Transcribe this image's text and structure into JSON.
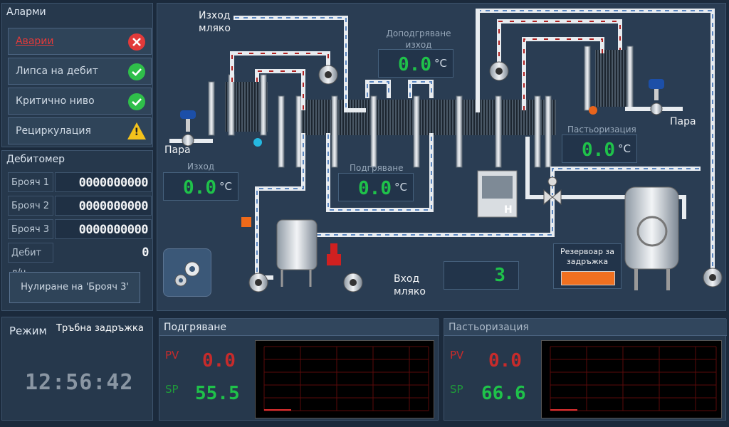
{
  "alarms": {
    "title": "Аларми",
    "items": [
      {
        "label": "Аварии",
        "status": "error",
        "color": "#e23a3a"
      },
      {
        "label": "Липса на дебит",
        "status": "ok",
        "color": "#2fbf4a"
      },
      {
        "label": "Критично ниво",
        "status": "ok",
        "color": "#2fbf4a"
      },
      {
        "label": "Рециркулация",
        "status": "warning",
        "color": "#f3c21b"
      }
    ]
  },
  "flowmeter": {
    "title": "Дебитомер",
    "rows": [
      {
        "label": "Брояч 1",
        "value": "0000000000"
      },
      {
        "label": "Брояч 2",
        "value": "0000000000"
      },
      {
        "label": "Брояч 3",
        "value": "0000000000"
      },
      {
        "label": "Дебит л/ч",
        "value": "0"
      }
    ],
    "reset_button": "Нулиране на 'Брояч 3'"
  },
  "process": {
    "milk_out": "Изход мляко",
    "milk_in": "Вход мляко",
    "steam_left": "Пара",
    "steam_right": "Пара",
    "holding_tank": "Резервоар за задръжка",
    "holding_level_color": "#f07020",
    "heater_label": "H",
    "step_display": "3",
    "temps": {
      "outlet": {
        "label": "Изход",
        "value": "0.0",
        "unit": "°C"
      },
      "heating": {
        "label": "Подгряване",
        "value": "0.0",
        "unit": "°C"
      },
      "post_heating": {
        "label": "Доподгряване изход",
        "value": "0.0",
        "unit": "°C"
      },
      "pasteurization": {
        "label": "Пастьоризация",
        "value": "0.0",
        "unit": "°C"
      }
    }
  },
  "mode": {
    "label": "Режим",
    "value": "Тръбна задръжка",
    "clock": "12:56:42"
  },
  "trend_heating": {
    "title": "Подгряване",
    "pv_label": "PV",
    "pv_value": "0.0",
    "sp_label": "SP",
    "sp_value": "55.5"
  },
  "trend_pasteurization": {
    "title": "Пастьоризация",
    "pv_label": "PV",
    "pv_value": "0.0",
    "sp_label": "SP",
    "sp_value": "66.6"
  }
}
